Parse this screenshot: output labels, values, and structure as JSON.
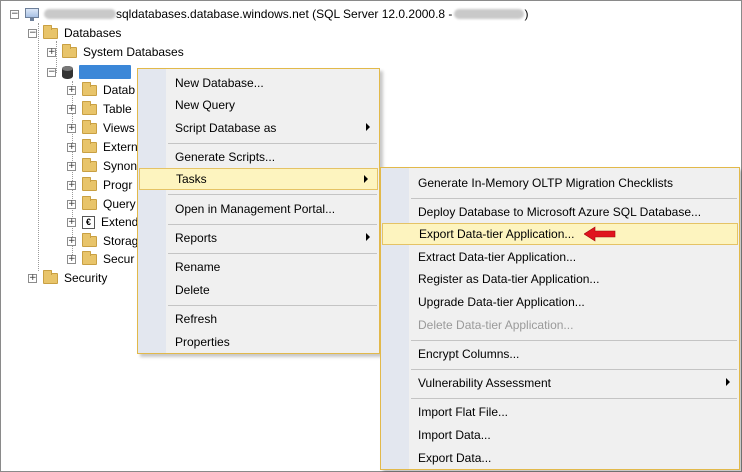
{
  "tree": {
    "server_label": "sqldatabases.database.windows.net (SQL Server 12.0.2000.8 - ",
    "server_label_end": ")",
    "databases": "Databases",
    "system_databases": "System Databases",
    "db_children": [
      "Datab",
      "Table",
      "Views",
      "Extern",
      "Synon",
      "Progr",
      "Query",
      "Extend",
      "Storag",
      "Secur"
    ],
    "security": "Security"
  },
  "context_menu": {
    "items": [
      {
        "label": "New Database...",
        "submenu": false
      },
      {
        "label": "New Query",
        "submenu": false
      },
      {
        "label": "Script Database as",
        "submenu": true
      },
      {
        "label": "Generate Scripts...",
        "submenu": false
      },
      {
        "label": "Tasks",
        "submenu": true
      },
      {
        "label": "Open in Management Portal...",
        "submenu": false
      },
      {
        "label": "Reports",
        "submenu": true
      },
      {
        "label": "Rename",
        "submenu": false
      },
      {
        "label": "Delete",
        "submenu": false
      },
      {
        "label": "Refresh",
        "submenu": false
      },
      {
        "label": "Properties",
        "submenu": false
      }
    ]
  },
  "tasks_menu": {
    "items": [
      {
        "label": "Generate In-Memory OLTP Migration Checklists"
      },
      {
        "label": "Deploy Database to Microsoft Azure SQL Database..."
      },
      {
        "label": "Export Data-tier Application..."
      },
      {
        "label": "Extract Data-tier Application..."
      },
      {
        "label": "Register as Data-tier Application..."
      },
      {
        "label": "Upgrade Data-tier Application..."
      },
      {
        "label": "Delete Data-tier Application...",
        "disabled": true
      },
      {
        "label": "Encrypt Columns..."
      },
      {
        "label": "Vulnerability Assessment",
        "submenu": true
      },
      {
        "label": "Import Flat File..."
      },
      {
        "label": "Import Data..."
      },
      {
        "label": "Export Data..."
      }
    ]
  },
  "colors": {
    "highlight_bg": "#fdf4bf",
    "highlight_border": "#e5c365",
    "menu_bg": "#f0f0f0",
    "arrow_red": "#e0141e"
  }
}
